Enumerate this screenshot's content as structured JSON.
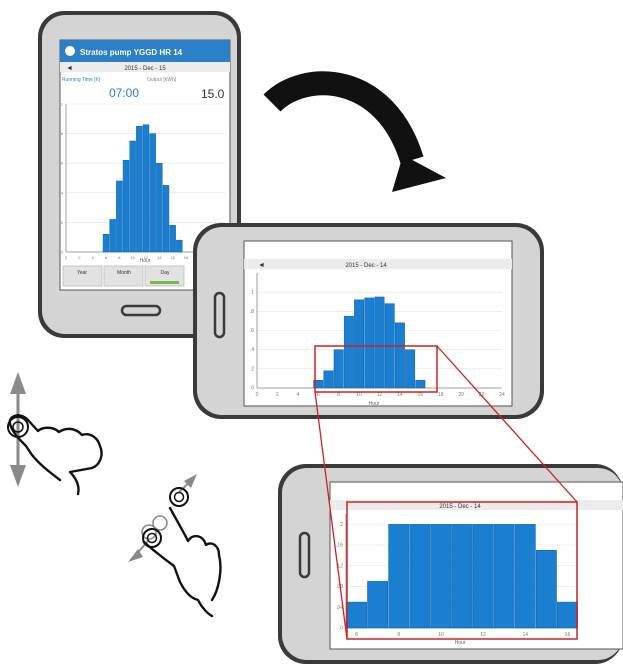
{
  "phone_portrait": {
    "app_title": "Stratos pump  YGGD HR 14",
    "date_label": "2015 - Dec - 15",
    "left_stat_label": "Running Time [h]",
    "right_stat_label": "Output [kWh]",
    "time_value": "07:00",
    "big_value": "15.0",
    "nav_back": "◄",
    "x_axis_label": "Hour",
    "tabs": [
      {
        "label": "Year",
        "active": false
      },
      {
        "label": "Month",
        "active": false
      },
      {
        "label": "Day",
        "active": true
      }
    ],
    "accent_color": "#2a7fc6",
    "active_tab_color": "#7ab648"
  },
  "phone_landscape": {
    "date_label": "2015 - Dec - 14",
    "nav_back": "◄",
    "x_axis_label": "Hour"
  },
  "phone_zoom": {
    "date_label": "2015 - Dec - 14",
    "x_axis_label": "Hour"
  },
  "colors": {
    "bar": "#1a7fd0",
    "bar_edge": "#0d5fa5",
    "zoom_frame": "#cc2222",
    "device_body": "#d4d4d4",
    "device_frame": "#3a3a3a"
  },
  "chart_data": [
    {
      "type": "bar",
      "title": "2015 - Dec - 15",
      "xlabel": "Hour",
      "x": [
        6,
        7,
        8,
        9,
        10,
        11,
        12,
        13,
        14,
        15,
        16,
        17
      ],
      "values": [
        0.12,
        0.22,
        0.48,
        0.62,
        0.75,
        0.85,
        0.86,
        0.8,
        0.6,
        0.45,
        0.18,
        0.08
      ],
      "xlim": [
        0,
        24
      ],
      "xticks": [
        0,
        2,
        4,
        6,
        8,
        10,
        12,
        14,
        16,
        18,
        20,
        22,
        24
      ],
      "ylim": [
        0,
        1
      ],
      "yticks": [
        0,
        0.2,
        0.4,
        0.6,
        0.8,
        1
      ]
    },
    {
      "type": "bar",
      "title": "2015 - Dec - 14",
      "xlabel": "Hour",
      "x": [
        6,
        7,
        8,
        9,
        10,
        11,
        12,
        13,
        14,
        15,
        16
      ],
      "values": [
        0.08,
        0.18,
        0.4,
        0.75,
        0.92,
        0.94,
        0.95,
        0.88,
        0.68,
        0.4,
        0.08
      ],
      "xlim": [
        0,
        24
      ],
      "xticks": [
        0,
        2,
        4,
        6,
        8,
        10,
        12,
        14,
        16,
        18,
        20,
        22,
        24
      ],
      "ylim": [
        0,
        1.2
      ],
      "yticks": [
        0,
        0.2,
        0.4,
        0.6,
        0.8,
        1
      ]
    },
    {
      "type": "bar",
      "title": "2015 - Dec - 14",
      "xlabel": "Hour",
      "x": [
        6,
        7,
        8,
        9,
        10,
        11,
        12,
        13,
        14,
        15,
        16
      ],
      "values": [
        0.05,
        0.09,
        0.2,
        0.2,
        0.2,
        0.2,
        0.2,
        0.2,
        0.2,
        0.15,
        0.05
      ],
      "xlim": [
        5.5,
        16.5
      ],
      "xticks": [
        6,
        8,
        10,
        12,
        14,
        16
      ],
      "ylim": [
        0,
        0.22
      ],
      "yticks": [
        0,
        0.04,
        0.08,
        0.12,
        0.16,
        0.2
      ]
    }
  ]
}
